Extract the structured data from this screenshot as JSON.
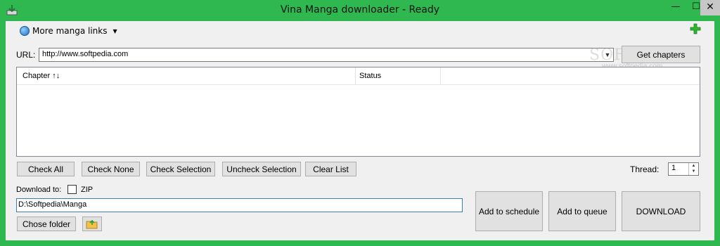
{
  "window": {
    "title": "Vina Manga downloader - Ready",
    "min_glyph": "—",
    "max_glyph": "☐",
    "close_glyph": "✕"
  },
  "menu": {
    "more_links_label": "More manga links"
  },
  "url": {
    "label": "URL:",
    "value": "http://www.softpedia.com",
    "get_chapters_label": "Get chapters"
  },
  "watermark": {
    "text": "SOFTPEDIA",
    "sub": "www.softpedia.com"
  },
  "list": {
    "columns": [
      "Chapter ↑↓",
      "Status"
    ]
  },
  "actions": {
    "check_all": "Check All",
    "check_none": "Check None",
    "check_selection": "Check Selection",
    "uncheck_selection": "Uncheck Selection",
    "clear_list": "Clear List"
  },
  "thread": {
    "label": "Thread:",
    "value": "1"
  },
  "download": {
    "label": "Download to:",
    "zip_label": "ZIP",
    "path": "D:\\Softpedia\\Manga",
    "chose_folder_label": "Chose folder",
    "schedule_label": "Add to schedule",
    "queue_label": "Add to queue",
    "download_label": "DOWNLOAD"
  },
  "colors": {
    "frame": "#2eb84f",
    "client": "#f0f0f0",
    "button": "#e1e1e1"
  }
}
